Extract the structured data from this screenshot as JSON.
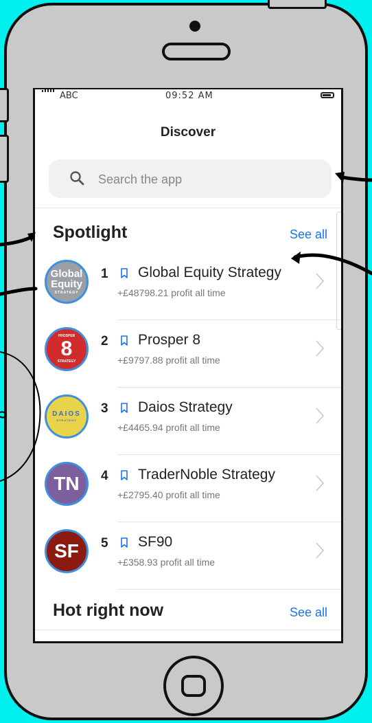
{
  "status_bar": {
    "carrier": "ABC",
    "time": "09:52 AM"
  },
  "header": {
    "title": "Discover"
  },
  "search": {
    "placeholder": "Search the app",
    "icon": "search-icon"
  },
  "spotlight": {
    "title": "Spotlight",
    "see_all": "See all",
    "items": [
      {
        "rank": "1",
        "name": "Global Equity Strategy",
        "profit": "+£48798.21 profit all time",
        "logo": {
          "line1": "Global",
          "line2": "Equity",
          "line3": "STRATEGY",
          "bg": "#9aa0a6"
        }
      },
      {
        "rank": "2",
        "name": "Prosper 8",
        "profit": "+£9797.88 profit all time",
        "logo": {
          "line1": "PROSPER",
          "line2": "8",
          "line3": "STRATEGY",
          "bg": "#d22b2b"
        }
      },
      {
        "rank": "3",
        "name": "Daios Strategy",
        "profit": "+£4465.94 profit all time",
        "logo": {
          "line1": "DAIOS",
          "line2": "STRATEGY",
          "bg": "#e8d34a"
        }
      },
      {
        "rank": "4",
        "name": "TraderNoble Strategy",
        "profit": "+£2795.40 profit all time",
        "logo": {
          "line1": "TN",
          "bg": "#7e5f9e"
        }
      },
      {
        "rank": "5",
        "name": "SF90",
        "profit": "+£358.93 profit all time",
        "logo": {
          "line1": "SF",
          "bg": "#8b1a10"
        }
      }
    ]
  },
  "hot": {
    "title": "Hot right now",
    "see_all": "See all"
  },
  "colors": {
    "accent": "#1a73e8",
    "background": "#00f0f0",
    "phone_body": "#c9c9c9"
  }
}
